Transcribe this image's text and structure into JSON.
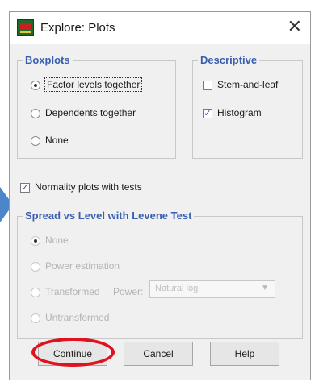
{
  "dialog": {
    "title": "Explore: Plots",
    "close_symbol": "✕"
  },
  "boxplots": {
    "legend": "Boxplots",
    "options": [
      {
        "label": "Factor levels together",
        "selected": true
      },
      {
        "label": "Dependents together",
        "selected": false
      },
      {
        "label": "None",
        "selected": false
      }
    ]
  },
  "descriptive": {
    "legend": "Descriptive",
    "stem_and_leaf": {
      "label": "Stem-and-leaf",
      "checked": false
    },
    "histogram": {
      "label": "Histogram",
      "checked": true
    }
  },
  "normality": {
    "label": "Normality plots with tests",
    "checked": true
  },
  "spread": {
    "legend": "Spread vs Level with Levene Test",
    "options": [
      {
        "label": "None",
        "selected": true
      },
      {
        "label": "Power estimation",
        "selected": false
      },
      {
        "label": "Transformed",
        "selected": false
      },
      {
        "label": "Untransformed",
        "selected": false
      }
    ],
    "power_label": "Power:",
    "power_value": "Natural log"
  },
  "buttons": {
    "continue": "Continue",
    "cancel": "Cancel",
    "help": "Help"
  },
  "colors": {
    "legend_blue": "#3a5fb0",
    "highlight_red": "#e0121e",
    "marker_blue": "#4a86c8"
  }
}
